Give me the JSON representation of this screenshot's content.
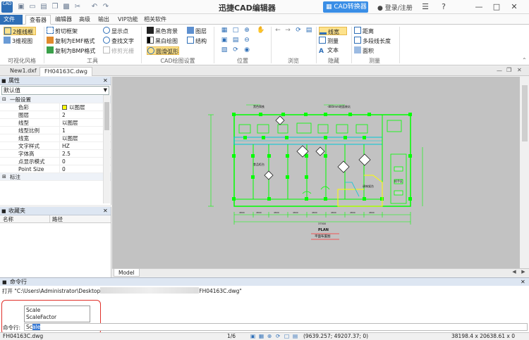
{
  "app": {
    "logo_text": "CAD",
    "title": "迅捷CAD编辑器",
    "convert_label": "CAD转换器",
    "login_label": "登录/注册"
  },
  "menu": {
    "tabs": [
      "文件",
      "查看器",
      "编辑器",
      "高级",
      "输出",
      "VIP功能",
      "相关软件"
    ]
  },
  "ribbon": {
    "view_style": {
      "btn1": "2维线框",
      "btn2": "3维视图",
      "group": "可视化风格"
    },
    "tools": {
      "clip_frame": "剪切框架",
      "copy_emf": "复制为EMF格式",
      "copy_bmp": "复制为BMP格式",
      "show_points": "显示点",
      "find_text": "查找文字",
      "trim_raster": "修剪光栅",
      "group": "工具"
    },
    "cad_settings": {
      "black_bg": "黑色背景",
      "bw_drawing": "黑白绘图",
      "smooth_arc": "圆滑弧形",
      "layers": "图层",
      "structure": "结构",
      "group": "CAD绘图设置"
    },
    "position_group": "位置",
    "browse_group": "浏览",
    "hide": {
      "linewidth": "线宽",
      "measure": "测量",
      "text": "文本",
      "group": "隐藏"
    },
    "measure": {
      "distance": "距离",
      "polyline_length": "多段线长度",
      "area": "面积",
      "group": "测量"
    }
  },
  "doc_tabs": [
    "New1.dxf",
    "FH04163C.dwg"
  ],
  "properties": {
    "header": "属性",
    "selector": "默认值",
    "section_general": "一般设置",
    "rows": [
      {
        "key": "色彩",
        "value": "以图层"
      },
      {
        "key": "图层",
        "value": "2"
      },
      {
        "key": "线型",
        "value": "以图层"
      },
      {
        "key": "线型比例",
        "value": "1"
      },
      {
        "key": "线宽",
        "value": "以图层"
      },
      {
        "key": "文字样式",
        "value": "HZ"
      },
      {
        "key": "字体高",
        "value": "2.5"
      },
      {
        "key": "点显示模式",
        "value": "0"
      },
      {
        "key": "Point Size",
        "value": "0"
      }
    ],
    "section_annotation": "标注"
  },
  "favorites": {
    "header": "收藏夹",
    "col_name": "名称",
    "col_path": "路径"
  },
  "drawing": {
    "labels": {
      "plan": "PLAN",
      "plan_cn": "平面布置图",
      "dim_bottom": "37500",
      "dims_seg": [
        "4800",
        "4800",
        "4800",
        "4800",
        "4800",
        "4800",
        "4800",
        "4800"
      ],
      "note1": "黑色铸铁",
      "note2": "-800mm地面装坑",
      "room1": "食品柜台",
      "room2": "调味架台",
      "room3": "抓手区"
    }
  },
  "model_tab": "Model",
  "command": {
    "header": "命令行",
    "history": "打开 \"C:\\Users\\Administrator\\Desktop",
    "history_end": "FH04163C.dwg\"",
    "suggestions": [
      "Scale",
      "ScaleFactor"
    ],
    "prompt_label": "命令行:",
    "input_typed": "Sc",
    "input_rest": "ale"
  },
  "status": {
    "file": "FH04163C.dwg",
    "page": "1/6",
    "coords": "(9639.257; 49207.37; 0)",
    "size": "38198.4 x 20638.61 x 0"
  },
  "colors": {
    "accent": "#2f6fb7",
    "selected": "#fde28c",
    "drawing_green": "#00ff00",
    "drawing_cyan": "#00c8d8",
    "drawing_yellow": "#ffff00",
    "canvas_bg": "#c2c2c2",
    "highlight_box": "#e0302a"
  }
}
